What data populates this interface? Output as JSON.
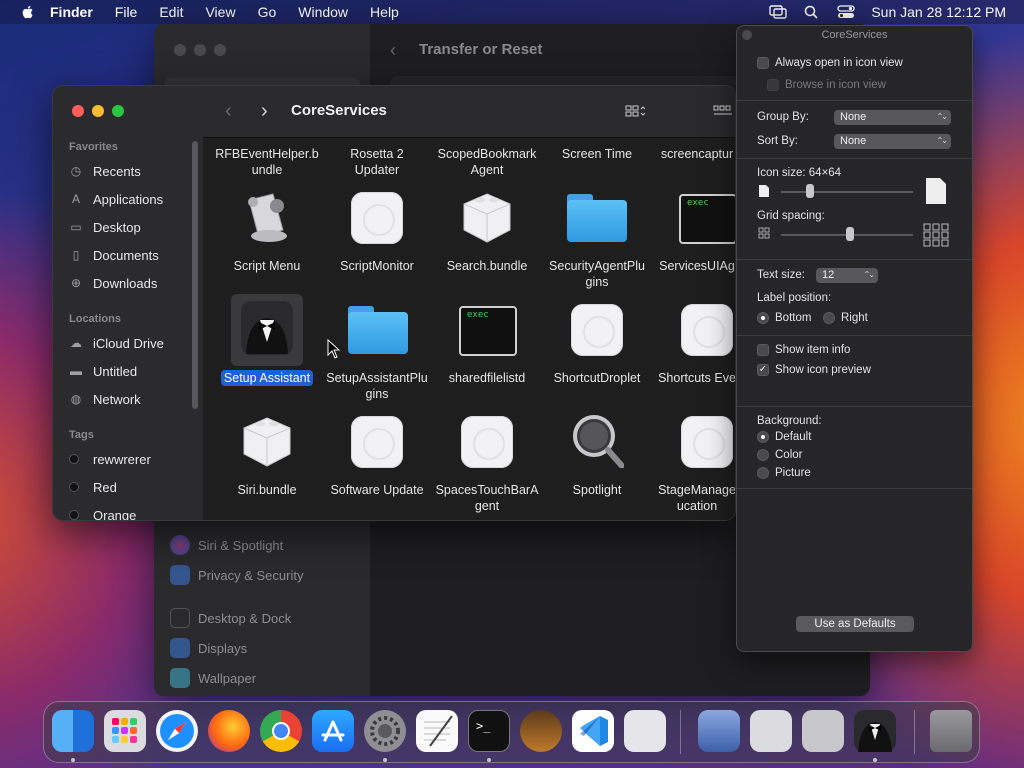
{
  "menubar": {
    "app": "Finder",
    "items": [
      "File",
      "Edit",
      "View",
      "Go",
      "Window",
      "Help"
    ],
    "datetime": "Sun Jan 28  12:12 PM"
  },
  "settings": {
    "title": "Transfer or Reset",
    "sidebar": [
      "Siri & Spotlight",
      "Privacy & Security",
      "Desktop & Dock",
      "Displays",
      "Wallpaper"
    ]
  },
  "finder": {
    "title": "CoreServices",
    "sidebar": {
      "favorites_header": "Favorites",
      "favorites": [
        "Recents",
        "Applications",
        "Desktop",
        "Documents",
        "Downloads"
      ],
      "locations_header": "Locations",
      "locations": [
        "iCloud Drive",
        "Untitled",
        "Network"
      ],
      "tags_header": "Tags",
      "tags": [
        "rewwrerer",
        "Red",
        "Orange"
      ]
    },
    "top_row": [
      "RFBEventHelper.b\nundle",
      "Rosetta 2\nUpdater",
      "ScopedBookmark\nAgent",
      "Screen Time",
      "screencaptur"
    ],
    "row1": [
      "Script Menu",
      "ScriptMonitor",
      "Search.bundle",
      "SecurityAgentPlu\ngins",
      "ServicesUIAg"
    ],
    "row2": [
      "Setup Assistant",
      "SetupAssistantPlu\ngins",
      "sharedfilelistd",
      "ShortcutDroplet",
      "Shortcuts Eve"
    ],
    "row3": [
      "Siri.bundle",
      "Software Update",
      "SpacesTouchBarA\ngent",
      "Spotlight",
      "StageManage\nucation"
    ],
    "exec_label": "exec"
  },
  "inspector": {
    "title": "CoreServices",
    "always_open": "Always open in icon view",
    "browse": "Browse in icon view",
    "group_by_label": "Group By:",
    "group_by": "None",
    "sort_by_label": "Sort By:",
    "sort_by": "None",
    "icon_size_label": "Icon size:  64×64",
    "grid_spacing_label": "Grid spacing:",
    "text_size_label": "Text size:",
    "text_size": "12",
    "label_position_label": "Label position:",
    "label_bottom": "Bottom",
    "label_right": "Right",
    "show_item_info": "Show item info",
    "show_icon_preview": "Show icon preview",
    "background_label": "Background:",
    "bg_default": "Default",
    "bg_color": "Color",
    "bg_picture": "Picture",
    "use_defaults": "Use as Defaults",
    "icon_size_level": 0.22,
    "grid_spacing_level": 0.52
  },
  "colors": {
    "accent": "#1f5fd8",
    "traffic_red": "#ff5f57",
    "traffic_yellow": "#febc2e",
    "traffic_green": "#28c840"
  }
}
